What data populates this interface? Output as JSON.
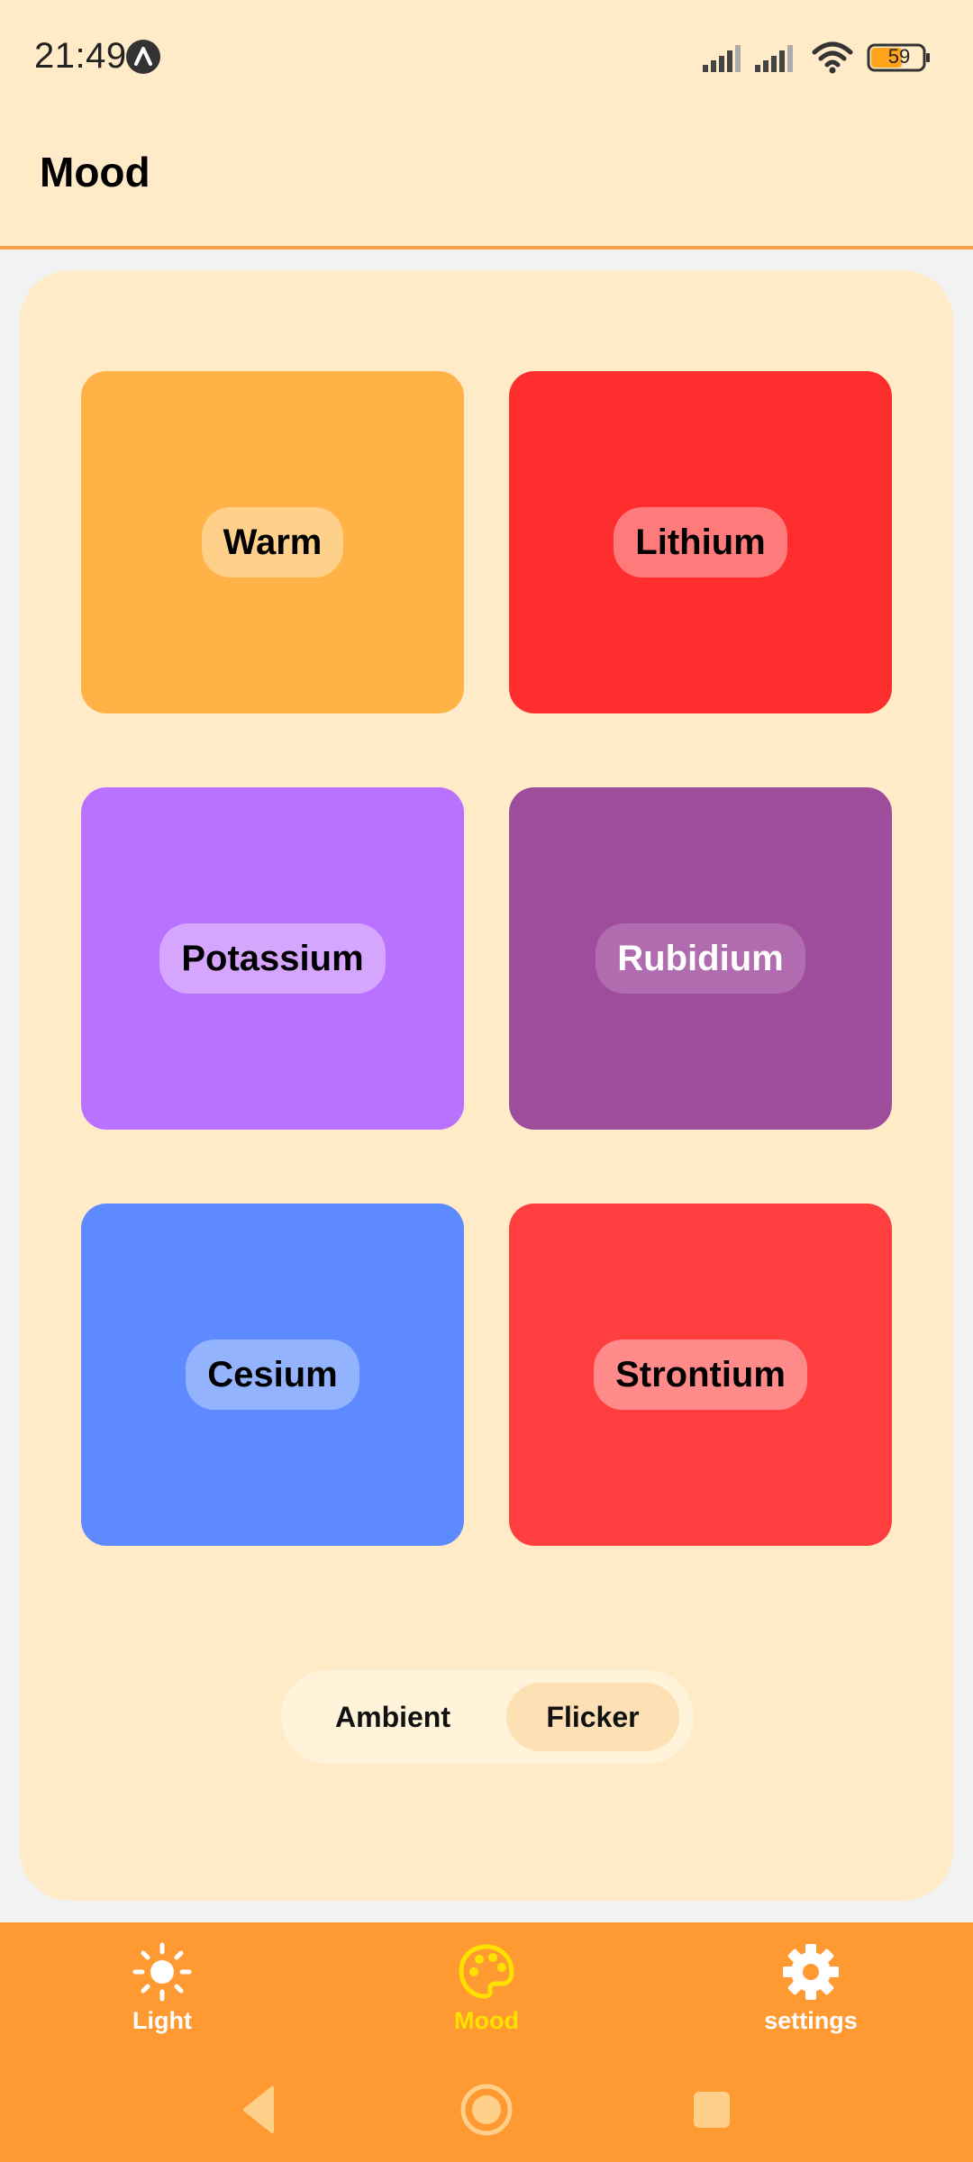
{
  "status_bar": {
    "time": "21:49",
    "battery": "59",
    "icons": [
      "app-notification-icon",
      "cell-signal-icon",
      "cell-signal-icon",
      "wifi-icon",
      "battery-icon"
    ]
  },
  "app_bar": {
    "title": "Mood"
  },
  "tiles": [
    {
      "label": "Warm",
      "color": "#ffb347",
      "label_bg": "#ffd08a",
      "label_color": "#000000"
    },
    {
      "label": "Lithium",
      "color": "#ff2e2e",
      "label_bg": "#ff7b7b",
      "label_color": "#000000"
    },
    {
      "label": "Potassium",
      "color": "#b872ff",
      "label_bg": "#d6a6ff",
      "label_color": "#000000"
    },
    {
      "label": "Rubidium",
      "color": "#9d4d9b",
      "label_bg": "#b06cae",
      "label_color": "#ffffff"
    },
    {
      "label": "Cesium",
      "color": "#5d8bff",
      "label_bg": "#93b3ff",
      "label_color": "#000000"
    },
    {
      "label": "Strontium",
      "color": "#ff3f3f",
      "label_bg": "#ff8a8a",
      "label_color": "#000000"
    }
  ],
  "mode_toggle": {
    "options": [
      "Ambient",
      "Flicker"
    ],
    "selected": "Flicker"
  },
  "bottom_nav": {
    "items": [
      {
        "label": "Light",
        "icon": "sun-icon",
        "active": false
      },
      {
        "label": "Mood",
        "icon": "palette-icon",
        "active": true
      },
      {
        "label": "settings",
        "icon": "gear-icon",
        "active": false
      }
    ],
    "active_color": "#ffe100"
  },
  "system_nav": {
    "buttons": [
      "back-icon",
      "home-icon",
      "recents-icon"
    ]
  }
}
